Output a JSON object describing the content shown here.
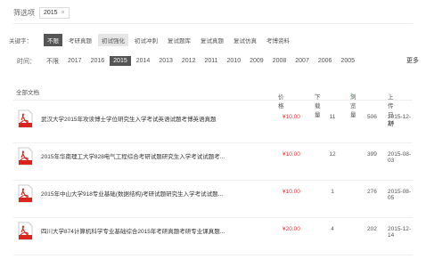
{
  "filter": {
    "label": "筛选项",
    "chip": "2015",
    "chip_close": "×"
  },
  "keyword": {
    "label": "关键字：",
    "options": [
      "不限",
      "考研真题",
      "初试强化",
      "初试冲刺",
      "复试题库",
      "复试真题",
      "复试仿真",
      "考博资料"
    ]
  },
  "time": {
    "label": "时间：",
    "options": [
      "不限",
      "2017",
      "2016",
      "2015",
      "2014",
      "2013",
      "2012",
      "2011",
      "2010",
      "2009",
      "2008",
      "2007",
      "2006",
      "2005"
    ],
    "more": "更多"
  },
  "table": {
    "headers": {
      "all": "全部文档",
      "price": "价格",
      "downloads": "下载量",
      "views": "浏览量",
      "date": "上传日期"
    },
    "rows": [
      {
        "title": "武汉大学2015年攻读博士学位研究生入学考试英语试题考博英语真题",
        "price": "¥10.00",
        "downloads": "11",
        "views": "506",
        "date": "2015-12-24"
      },
      {
        "title": "2015年华南理工大学828电气工程综合考研试题研究生入学考试试题考...",
        "price": "¥10.00",
        "downloads": "12",
        "views": "399",
        "date": "2015-08-03"
      },
      {
        "title": "2015年中山大学918专业基础(数据结构)考研试题研究生入学考试试题...",
        "price": "¥10.00",
        "downloads": "1",
        "views": "276",
        "date": "2015-08-05"
      },
      {
        "title": "四川大学874计算机科学专业基础综合2015年考研真题考研专业课真题...",
        "price": "¥20.00",
        "downloads": "4",
        "views": "202",
        "date": "2015-12-14"
      }
    ]
  },
  "icons": {
    "pdf": "pdf-file-icon",
    "sort_up": "↑",
    "sort_down": "↓"
  }
}
